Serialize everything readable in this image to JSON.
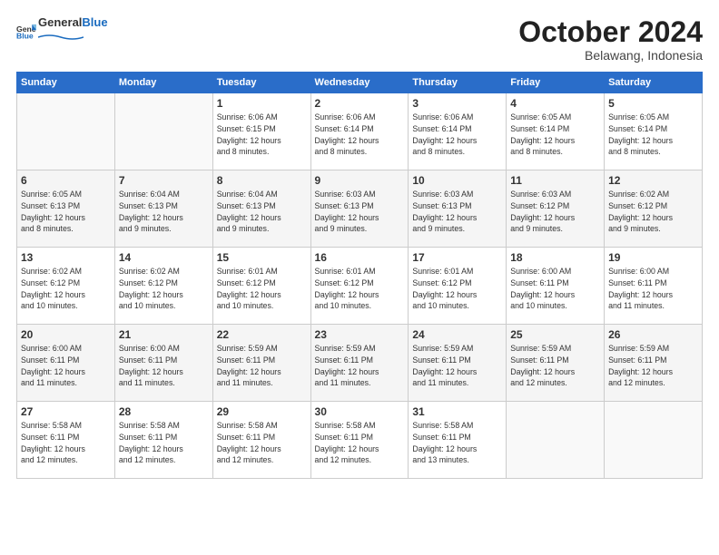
{
  "header": {
    "logo_general": "General",
    "logo_blue": "Blue",
    "month": "October 2024",
    "location": "Belawang, Indonesia"
  },
  "weekdays": [
    "Sunday",
    "Monday",
    "Tuesday",
    "Wednesday",
    "Thursday",
    "Friday",
    "Saturday"
  ],
  "weeks": [
    [
      {
        "day": "",
        "info": ""
      },
      {
        "day": "",
        "info": ""
      },
      {
        "day": "1",
        "info": "Sunrise: 6:06 AM\nSunset: 6:15 PM\nDaylight: 12 hours\nand 8 minutes."
      },
      {
        "day": "2",
        "info": "Sunrise: 6:06 AM\nSunset: 6:14 PM\nDaylight: 12 hours\nand 8 minutes."
      },
      {
        "day": "3",
        "info": "Sunrise: 6:06 AM\nSunset: 6:14 PM\nDaylight: 12 hours\nand 8 minutes."
      },
      {
        "day": "4",
        "info": "Sunrise: 6:05 AM\nSunset: 6:14 PM\nDaylight: 12 hours\nand 8 minutes."
      },
      {
        "day": "5",
        "info": "Sunrise: 6:05 AM\nSunset: 6:14 PM\nDaylight: 12 hours\nand 8 minutes."
      }
    ],
    [
      {
        "day": "6",
        "info": "Sunrise: 6:05 AM\nSunset: 6:13 PM\nDaylight: 12 hours\nand 8 minutes."
      },
      {
        "day": "7",
        "info": "Sunrise: 6:04 AM\nSunset: 6:13 PM\nDaylight: 12 hours\nand 9 minutes."
      },
      {
        "day": "8",
        "info": "Sunrise: 6:04 AM\nSunset: 6:13 PM\nDaylight: 12 hours\nand 9 minutes."
      },
      {
        "day": "9",
        "info": "Sunrise: 6:03 AM\nSunset: 6:13 PM\nDaylight: 12 hours\nand 9 minutes."
      },
      {
        "day": "10",
        "info": "Sunrise: 6:03 AM\nSunset: 6:13 PM\nDaylight: 12 hours\nand 9 minutes."
      },
      {
        "day": "11",
        "info": "Sunrise: 6:03 AM\nSunset: 6:12 PM\nDaylight: 12 hours\nand 9 minutes."
      },
      {
        "day": "12",
        "info": "Sunrise: 6:02 AM\nSunset: 6:12 PM\nDaylight: 12 hours\nand 9 minutes."
      }
    ],
    [
      {
        "day": "13",
        "info": "Sunrise: 6:02 AM\nSunset: 6:12 PM\nDaylight: 12 hours\nand 10 minutes."
      },
      {
        "day": "14",
        "info": "Sunrise: 6:02 AM\nSunset: 6:12 PM\nDaylight: 12 hours\nand 10 minutes."
      },
      {
        "day": "15",
        "info": "Sunrise: 6:01 AM\nSunset: 6:12 PM\nDaylight: 12 hours\nand 10 minutes."
      },
      {
        "day": "16",
        "info": "Sunrise: 6:01 AM\nSunset: 6:12 PM\nDaylight: 12 hours\nand 10 minutes."
      },
      {
        "day": "17",
        "info": "Sunrise: 6:01 AM\nSunset: 6:12 PM\nDaylight: 12 hours\nand 10 minutes."
      },
      {
        "day": "18",
        "info": "Sunrise: 6:00 AM\nSunset: 6:11 PM\nDaylight: 12 hours\nand 10 minutes."
      },
      {
        "day": "19",
        "info": "Sunrise: 6:00 AM\nSunset: 6:11 PM\nDaylight: 12 hours\nand 11 minutes."
      }
    ],
    [
      {
        "day": "20",
        "info": "Sunrise: 6:00 AM\nSunset: 6:11 PM\nDaylight: 12 hours\nand 11 minutes."
      },
      {
        "day": "21",
        "info": "Sunrise: 6:00 AM\nSunset: 6:11 PM\nDaylight: 12 hours\nand 11 minutes."
      },
      {
        "day": "22",
        "info": "Sunrise: 5:59 AM\nSunset: 6:11 PM\nDaylight: 12 hours\nand 11 minutes."
      },
      {
        "day": "23",
        "info": "Sunrise: 5:59 AM\nSunset: 6:11 PM\nDaylight: 12 hours\nand 11 minutes."
      },
      {
        "day": "24",
        "info": "Sunrise: 5:59 AM\nSunset: 6:11 PM\nDaylight: 12 hours\nand 11 minutes."
      },
      {
        "day": "25",
        "info": "Sunrise: 5:59 AM\nSunset: 6:11 PM\nDaylight: 12 hours\nand 12 minutes."
      },
      {
        "day": "26",
        "info": "Sunrise: 5:59 AM\nSunset: 6:11 PM\nDaylight: 12 hours\nand 12 minutes."
      }
    ],
    [
      {
        "day": "27",
        "info": "Sunrise: 5:58 AM\nSunset: 6:11 PM\nDaylight: 12 hours\nand 12 minutes."
      },
      {
        "day": "28",
        "info": "Sunrise: 5:58 AM\nSunset: 6:11 PM\nDaylight: 12 hours\nand 12 minutes."
      },
      {
        "day": "29",
        "info": "Sunrise: 5:58 AM\nSunset: 6:11 PM\nDaylight: 12 hours\nand 12 minutes."
      },
      {
        "day": "30",
        "info": "Sunrise: 5:58 AM\nSunset: 6:11 PM\nDaylight: 12 hours\nand 12 minutes."
      },
      {
        "day": "31",
        "info": "Sunrise: 5:58 AM\nSunset: 6:11 PM\nDaylight: 12 hours\nand 13 minutes."
      },
      {
        "day": "",
        "info": ""
      },
      {
        "day": "",
        "info": ""
      }
    ]
  ]
}
